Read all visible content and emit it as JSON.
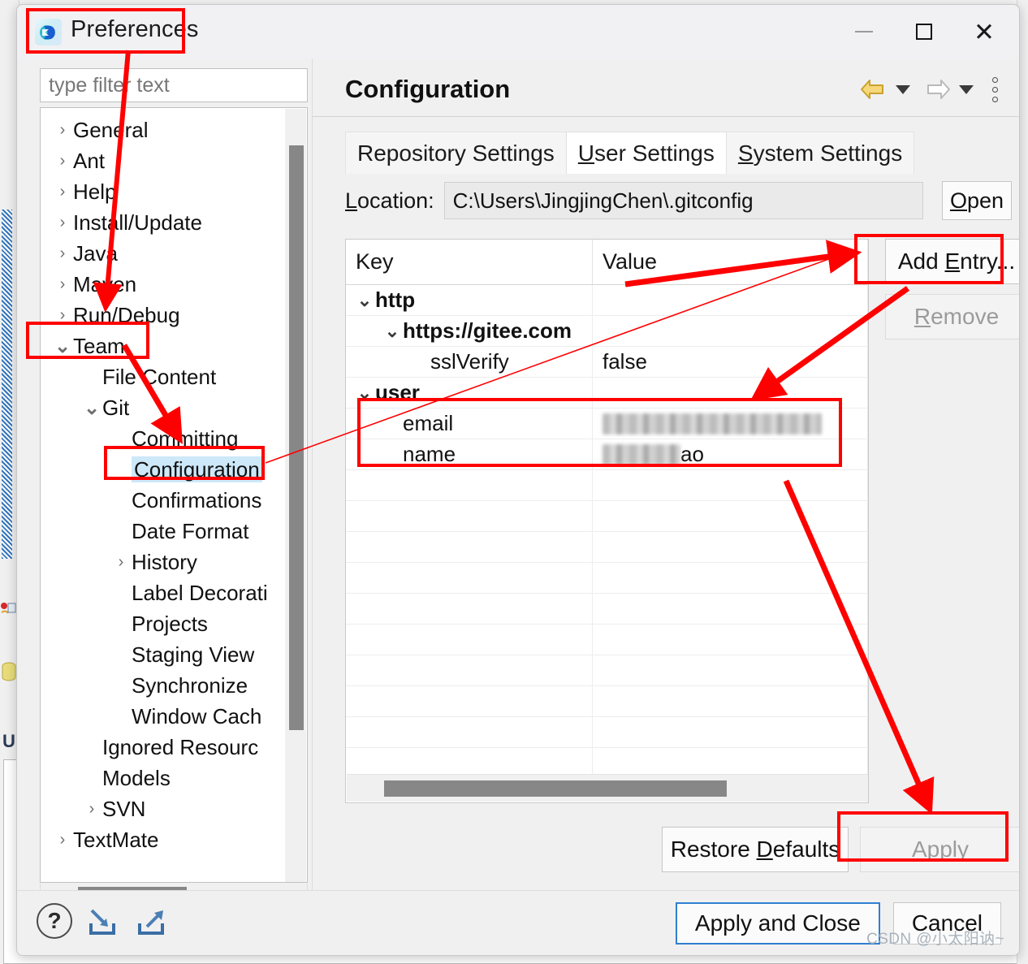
{
  "window": {
    "title": "Preferences",
    "icon": "eclipse-logo-icon",
    "minimize_label": "Minimize",
    "maximize_label": "Maximize",
    "close_label": "Close"
  },
  "filter": {
    "placeholder": "type filter text",
    "value": ""
  },
  "tree": {
    "items": [
      {
        "label": "General",
        "indent": 0,
        "twisty": "collapsed",
        "selected": false
      },
      {
        "label": "Ant",
        "indent": 0,
        "twisty": "collapsed",
        "selected": false
      },
      {
        "label": "Help",
        "indent": 0,
        "twisty": "collapsed",
        "selected": false
      },
      {
        "label": "Install/Update",
        "indent": 0,
        "twisty": "collapsed",
        "selected": false
      },
      {
        "label": "Java",
        "indent": 0,
        "twisty": "collapsed",
        "selected": false
      },
      {
        "label": "Maven",
        "indent": 0,
        "twisty": "collapsed",
        "selected": false
      },
      {
        "label": "Run/Debug",
        "indent": 0,
        "twisty": "collapsed",
        "selected": false
      },
      {
        "label": "Team",
        "indent": 0,
        "twisty": "expanded",
        "selected": false
      },
      {
        "label": "File Content",
        "indent": 1,
        "twisty": "none",
        "selected": false
      },
      {
        "label": "Git",
        "indent": 1,
        "twisty": "expanded",
        "selected": false
      },
      {
        "label": "Committing",
        "indent": 2,
        "twisty": "none",
        "selected": false
      },
      {
        "label": "Configuration",
        "indent": 2,
        "twisty": "none",
        "selected": true
      },
      {
        "label": "Confirmations",
        "indent": 2,
        "twisty": "none",
        "selected": false
      },
      {
        "label": "Date Format",
        "indent": 2,
        "twisty": "none",
        "selected": false
      },
      {
        "label": "History",
        "indent": 2,
        "twisty": "collapsed",
        "selected": false
      },
      {
        "label": "Label Decorati",
        "indent": 2,
        "twisty": "none",
        "selected": false
      },
      {
        "label": "Projects",
        "indent": 2,
        "twisty": "none",
        "selected": false
      },
      {
        "label": "Staging View",
        "indent": 2,
        "twisty": "none",
        "selected": false
      },
      {
        "label": "Synchronize",
        "indent": 2,
        "twisty": "none",
        "selected": false
      },
      {
        "label": "Window Cach",
        "indent": 2,
        "twisty": "none",
        "selected": false
      },
      {
        "label": "Ignored Resourc",
        "indent": 1,
        "twisty": "none",
        "selected": false
      },
      {
        "label": "Models",
        "indent": 1,
        "twisty": "none",
        "selected": false
      },
      {
        "label": "SVN",
        "indent": 1,
        "twisty": "collapsed",
        "selected": false
      },
      {
        "label": "TextMate",
        "indent": 0,
        "twisty": "collapsed",
        "selected": false
      }
    ]
  },
  "page": {
    "title": "Configuration",
    "nav": {
      "back_label": "back-arrow-icon",
      "forward_label": "forward-arrow-icon",
      "menu_label": "view-menu-icon"
    },
    "tabs": [
      {
        "label": "Repository Settings",
        "mnemonic": "",
        "active": false
      },
      {
        "label": "User Settings",
        "mnemonic": "U",
        "active": true
      },
      {
        "label": "System Settings",
        "mnemonic": "S",
        "active": false
      }
    ],
    "location": {
      "label": "Location:",
      "value": "C:\\Users\\JingjingChen\\.gitconfig",
      "open_label": "Open"
    },
    "table": {
      "columns": [
        "Key",
        "Value"
      ],
      "rows": [
        {
          "key": "http",
          "value": "",
          "indent": 0,
          "twisty": "expanded",
          "bold": true,
          "blurred": false
        },
        {
          "key": "https://gitee.com",
          "value": "",
          "indent": 1,
          "twisty": "expanded",
          "bold": true,
          "blurred": false
        },
        {
          "key": "sslVerify",
          "value": "false",
          "indent": 2,
          "twisty": "none",
          "bold": false,
          "blurred": false
        },
        {
          "key": "user",
          "value": "",
          "indent": 0,
          "twisty": "expanded",
          "bold": true,
          "blurred": false
        },
        {
          "key": "email",
          "value": "",
          "indent": 1,
          "twisty": "none",
          "bold": false,
          "blurred": true
        },
        {
          "key": "name",
          "value": "ao",
          "indent": 1,
          "twisty": "none",
          "bold": false,
          "blurred": true
        }
      ]
    },
    "side_buttons": [
      {
        "label": "Add Entry...",
        "mnemonic": "E",
        "enabled": true
      },
      {
        "label": "Remove",
        "mnemonic": "R",
        "enabled": false
      }
    ],
    "footer_buttons": [
      {
        "label": "Restore Defaults",
        "mnemonic": "D",
        "enabled": true
      },
      {
        "label": "Apply",
        "mnemonic": "A",
        "enabled": false
      }
    ]
  },
  "dialog_footer": {
    "help_label": "?",
    "import_label": "import-preferences-icon",
    "export_label": "export-preferences-icon",
    "apply_and_close_label": "Apply and Close",
    "cancel_label": "Cancel"
  },
  "annotations": {
    "color": "#ff0000",
    "boxes": [
      "Preferences title",
      "Team",
      "Configuration",
      "user email/name rows",
      "Add Entry...",
      "Apply"
    ]
  },
  "watermark": "CSDN @小太阳讷~"
}
